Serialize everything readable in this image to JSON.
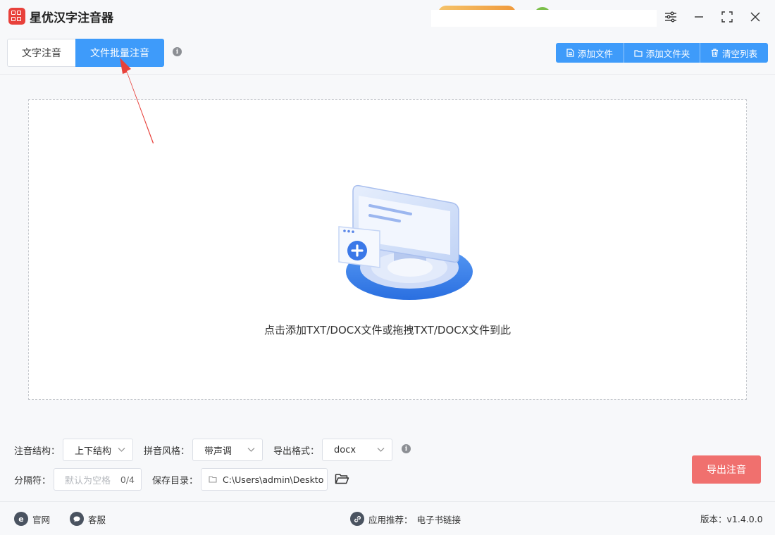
{
  "app": {
    "title": "星优汉字注音器"
  },
  "tabs": [
    {
      "label": "文字注音",
      "active": false
    },
    {
      "label": "文件批量注音",
      "active": true
    }
  ],
  "toolbar": {
    "add_file": "添加文件",
    "add_folder": "添加文件夹",
    "clear_list": "清空列表"
  },
  "dropzone": {
    "hint": "点击添加TXT/DOCX文件或拖拽TXT/DOCX文件到此"
  },
  "options": {
    "structure_label": "注音结构：",
    "structure_value": "上下结构",
    "style_label": "拼音风格：",
    "style_value": "带声调",
    "format_label": "导出格式：",
    "format_value": "docx",
    "separator_label": "分隔符：",
    "separator_placeholder": "默认为空格",
    "separator_count": "0/4",
    "save_label": "保存目录：",
    "save_path": "C:\\Users\\admin\\Deskto"
  },
  "export_label": "导出注音",
  "footer": {
    "website": "官网",
    "support": "客服",
    "recommend_label": "应用推荐：",
    "recommend_link": "电子书链接",
    "version": "版本：v1.4.0.0"
  },
  "colors": {
    "primary": "#3e9bfa",
    "export": "#f0706e",
    "arrow": "#e8413b"
  }
}
